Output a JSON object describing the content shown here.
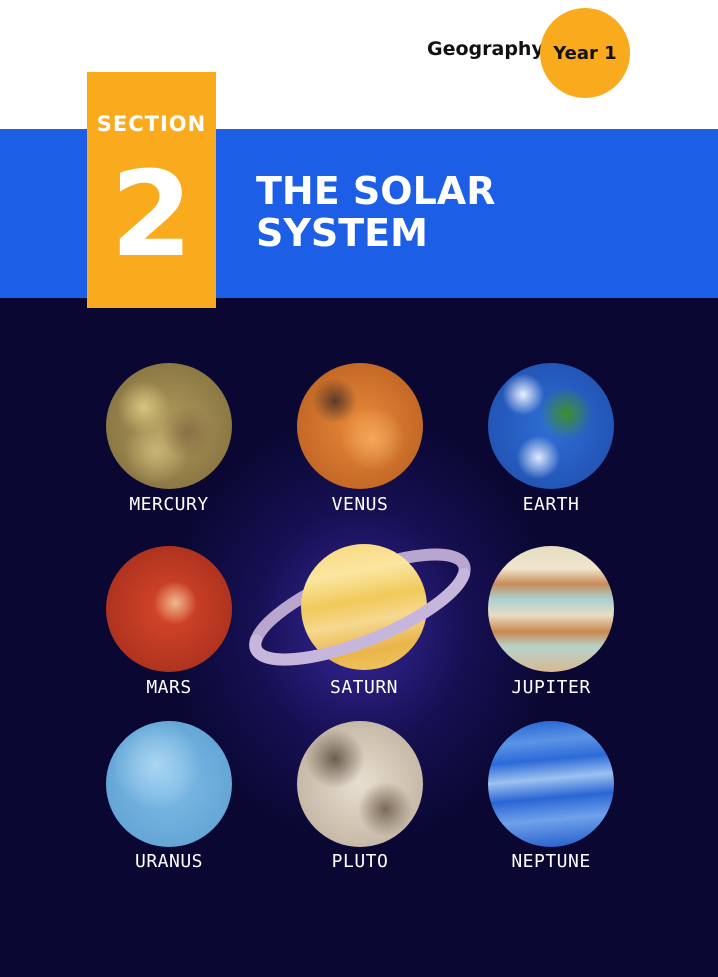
{
  "header": {
    "subject": "Geography",
    "year_badge": "Year 1"
  },
  "section": {
    "label": "SECTION",
    "number": "2",
    "title": "THE SOLAR\nSYSTEM"
  },
  "planets": [
    {
      "name": "MERCURY"
    },
    {
      "name": "VENUS"
    },
    {
      "name": "EARTH"
    },
    {
      "name": "MARS"
    },
    {
      "name": "SATURN"
    },
    {
      "name": "JUPITER"
    },
    {
      "name": "URANUS"
    },
    {
      "name": "PLUTO"
    },
    {
      "name": "NEPTUNE"
    }
  ],
  "colors": {
    "accent_orange": "#f9ab1d",
    "band_blue": "#1c5fe6",
    "space_navy": "#0a0833"
  }
}
